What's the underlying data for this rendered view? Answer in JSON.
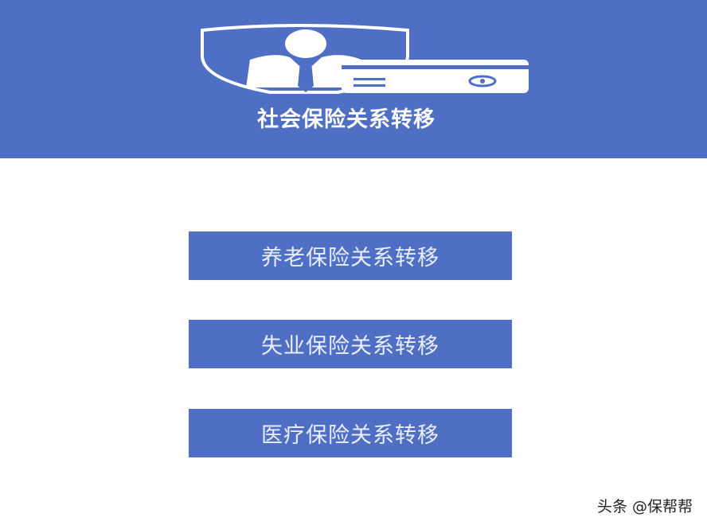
{
  "header": {
    "title": "社会保险关系转移",
    "bg_color": "#4f6fc4"
  },
  "menu": {
    "items": [
      {
        "label": "养老保险关系转移"
      },
      {
        "label": "失业保险关系转移"
      },
      {
        "label": "医疗保险关系转移"
      }
    ]
  },
  "watermark": {
    "text": "头条 @保帮帮"
  },
  "icons": {
    "header_illustration": "shield-person-id-card-icon"
  }
}
